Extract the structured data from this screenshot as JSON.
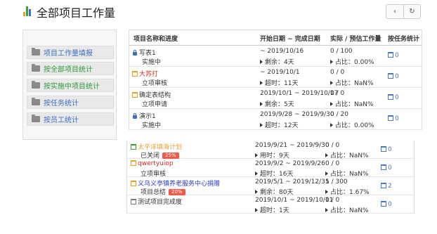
{
  "header": {
    "title": "全部项目工作量",
    "prev_icon": "chevron-left-icon",
    "refresh_icon": "refresh-icon",
    "prev_label": "‹",
    "refresh_label": "↻"
  },
  "sidebar": {
    "items": [
      {
        "label": "项目工作量填报",
        "color": "#3a6fc4"
      },
      {
        "label": "按全部项目统计",
        "color": "#2e9a3a"
      },
      {
        "label": "按实施中项目统计",
        "color": "#2e9a3a"
      },
      {
        "label": "按任务统计",
        "color": "#3a6fc4"
      },
      {
        "label": "按员工统计",
        "color": "#3a6fc4"
      }
    ]
  },
  "table": {
    "headers": [
      "项目名称和进度",
      "开始日期 ~ 完成日期",
      "实际 / 预估工作量",
      "按任务统计"
    ],
    "rows": [
      {
        "icon": "lock-icon",
        "name": "写表1",
        "name_color": "#333",
        "status": "实施中",
        "badge": "",
        "dates": "~ 2019/10/16",
        "remain": "剩余：4天",
        "work": "0 / 100",
        "ratio": "占比：0.00%",
        "tasks": "0"
      },
      {
        "icon": "calendar-icon",
        "icon_class": "cal-orange",
        "name": "大苏打",
        "name_color": "#d92a1c",
        "status": "立项审核",
        "badge": "",
        "dates": "~ 2019/10/1",
        "remain": "超时：11天",
        "work": "0 / 0",
        "ratio": "占比：NaN%",
        "tasks": "0"
      },
      {
        "icon": "calendar-icon",
        "icon_class": "cal-orange",
        "name": "确定表结构",
        "name_color": "#333",
        "status": "立项申请",
        "badge": "",
        "dates": "2019/10/1 ~ 2019/10/17",
        "remain": "剩余：5天",
        "work": "0 / 0",
        "ratio": "占比：NaN%",
        "tasks": "0"
      },
      {
        "icon": "lock-icon",
        "name": "演示1",
        "name_color": "#333",
        "status": "实施中",
        "badge": "",
        "dates": "2019/9/28 ~ 2019/9/30",
        "remain": "超时：12天",
        "work": "0 / 20",
        "ratio": "占比：0.00%",
        "tasks": "0"
      }
    ],
    "rows2": [
      {
        "icon": "calendar-icon",
        "icon_class": "cal-green",
        "name": "太平洋填海计划",
        "name_color": "#e8a030",
        "status": "已关闭",
        "badge": "25%",
        "dates": "2019/9/21 ~ 2019/9/30",
        "remain": "用时：9天",
        "work": "0 / 0",
        "ratio": "占比：NaN%",
        "tasks": "0"
      },
      {
        "icon": "calendar-icon",
        "icon_class": "cal-orange",
        "name": "qwertyuiop",
        "name_color": "#d92a1c",
        "status": "立项审核",
        "badge": "",
        "dates": "2019/9/2 ~ 2019/9/26",
        "remain": "超时：16天",
        "work": "0 / 0",
        "ratio": "占比：NaN%",
        "tasks": "0"
      },
      {
        "icon": "calendar-icon",
        "icon_class": "cal-orange",
        "name": "义乌义亭镇养老服务中心捐赠",
        "name_color": "#2a3fc4",
        "status": "项目总结",
        "badge": "20%",
        "dates": "2019/5/1 ~ 2019/12/31",
        "remain": "剩余：80天",
        "work": "5 / 300",
        "ratio": "占比：1.67%",
        "tasks": "2"
      },
      {
        "icon": "trash-icon",
        "icon_class": "cal-gray",
        "name": "测试项目完成度",
        "name_color": "#333",
        "status": "",
        "badge": "",
        "dates": "2019/10/1 ~ 2019/10/11",
        "remain": "超时：1天",
        "work": "0 / 0",
        "ratio": "占比：NaN%",
        "tasks": "0"
      }
    ]
  }
}
